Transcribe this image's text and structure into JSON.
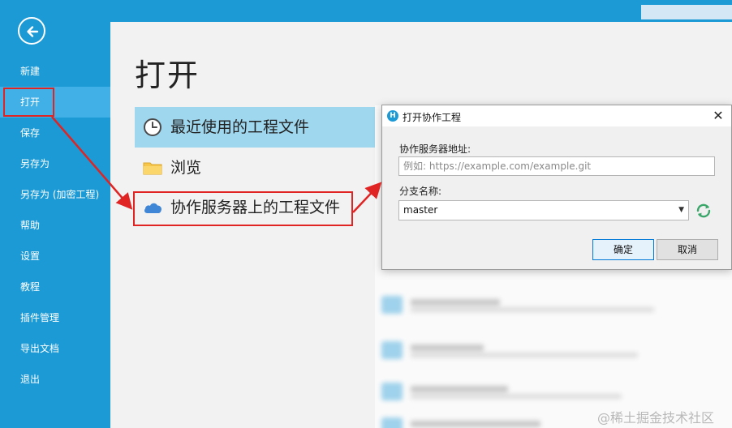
{
  "sidebar": {
    "items": [
      {
        "label": "新建"
      },
      {
        "label": "打开"
      },
      {
        "label": "保存"
      },
      {
        "label": "另存为"
      },
      {
        "label": "另存为 (加密工程)"
      },
      {
        "label": "帮助"
      },
      {
        "label": "设置"
      },
      {
        "label": "教程"
      },
      {
        "label": "插件管理"
      },
      {
        "label": "导出文档"
      },
      {
        "label": "退出"
      }
    ],
    "active_item": "打开",
    "color": "#1c9ad6"
  },
  "main": {
    "title": "打开",
    "options": [
      {
        "label": "最近使用的工程文件",
        "icon": "clock-icon"
      },
      {
        "label": "浏览",
        "icon": "folder-icon"
      },
      {
        "label": "协作服务器上的工程文件",
        "icon": "cloud-icon"
      }
    ]
  },
  "dialog": {
    "title": "打开协作工程",
    "server_label": "协作服务器地址:",
    "server_placeholder": "例如: https://example.com/example.git",
    "branch_label": "分支名称:",
    "branch_value": "master",
    "ok_label": "确定",
    "cancel_label": "取消",
    "close_symbol": "✕"
  },
  "watermark": "@稀土掘金技术社区",
  "colors": {
    "accent": "#1c9ad6",
    "highlight_red": "#e02424",
    "selection": "#9fd7ee"
  }
}
